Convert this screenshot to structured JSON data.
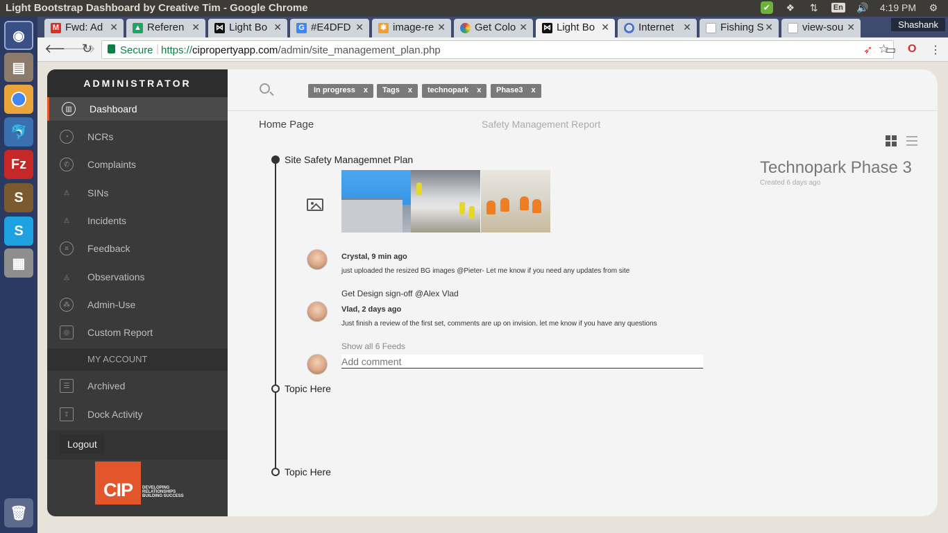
{
  "os": {
    "window_title": "Light Bootstrap Dashboard by Creative Tim - Google Chrome",
    "keyboard": "En",
    "clock": "4:19 PM"
  },
  "browser": {
    "tabs": [
      {
        "label": "Fwd: Ad",
        "icon": "gmail-icon",
        "color": "#d93025"
      },
      {
        "label": "Referen",
        "icon": "drive-icon",
        "color": "#1fa463"
      },
      {
        "label": "Light Bo",
        "icon": "bowtie-icon",
        "color": "#111111"
      },
      {
        "label": "#E4DFD",
        "icon": "google-icon",
        "color": "#4285f4"
      },
      {
        "label": "image-re",
        "icon": "asterisk-icon",
        "color": "#f0a030"
      },
      {
        "label": "Get Colo",
        "icon": "color-wheel-icon",
        "color": "#e53935"
      },
      {
        "label": "Light Bo",
        "icon": "bowtie-icon",
        "color": "#111111",
        "active": true
      },
      {
        "label": "Internet",
        "icon": "globe-icon",
        "color": "#4b73c4"
      },
      {
        "label": "Fishing S",
        "icon": "page-icon",
        "color": "#cccccc"
      },
      {
        "label": "view-sou",
        "icon": "page-icon",
        "color": "#cccccc"
      }
    ],
    "user": "Shashank",
    "secure_label": "Secure",
    "url_scheme": "https://",
    "url_host": "cipropertyapp.com",
    "url_path": "/admin/site_management_plan.php"
  },
  "sidebar": {
    "title": "ADMINISTRATOR",
    "items": [
      {
        "label": "Dashboard",
        "icon": "dashboard-icon"
      },
      {
        "label": "NCRs",
        "icon": "ncr-icon"
      },
      {
        "label": "Complaints",
        "icon": "phone-icon"
      },
      {
        "label": "SINs",
        "icon": "warning-icon"
      },
      {
        "label": "Incidents",
        "icon": "alert-icon"
      },
      {
        "label": "Feedback",
        "icon": "chat-icon"
      },
      {
        "label": "Observations",
        "icon": "eye-icon"
      },
      {
        "label": "Admin-Use",
        "icon": "org-chart-icon"
      },
      {
        "label": "Custom Report",
        "icon": "report-icon"
      }
    ],
    "account_header": "MY ACCOUNT",
    "account_items": [
      {
        "label": "Archived",
        "icon": "archive-icon"
      },
      {
        "label": "Dock Activity",
        "icon": "share-icon"
      }
    ],
    "logout": "Logout",
    "logo_text": "CIP",
    "logo_tagline": "DEVELOPING RELATIONSHIPS BUILDING SUCCESS",
    "accent_color": "#e3552a"
  },
  "filters": [
    {
      "label": "In progress",
      "x": "x"
    },
    {
      "label": "Tags",
      "x": "x"
    },
    {
      "label": "technopark",
      "x": "x"
    },
    {
      "label": "Phase3",
      "x": "x"
    }
  ],
  "breadcrumb": {
    "home": "Home Page",
    "report": "Safety Management Report"
  },
  "timeline": {
    "topic1": "Site Safety Managemnet Plan",
    "comments": [
      {
        "author": "Crystal, 9 min ago",
        "text": "just uploaded the resized BG images @Pieter- Let me know if you need any updates from site"
      },
      {
        "author": "Vlad, 2 days ago",
        "text": "Just finish a review of the first set, comments are up on invision. let me know if you have any questions"
      }
    ],
    "task": "Get Design sign-off @Alex Vlad",
    "show_all": "Show all 6 Feeds",
    "add_comment_placeholder": "Add comment",
    "topic2": "Topic Here",
    "topic3": "Topic Here"
  },
  "project": {
    "name": "Technopark Phase 3",
    "created": "Created 6 days ago"
  }
}
